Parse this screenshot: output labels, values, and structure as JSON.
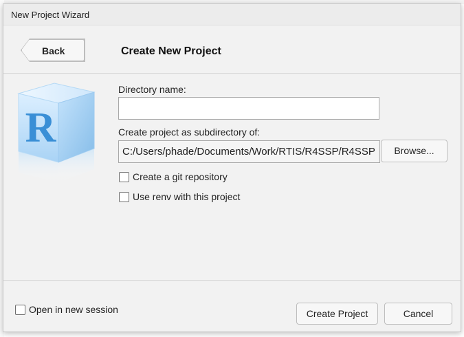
{
  "window": {
    "title": "New Project Wizard"
  },
  "header": {
    "back_label": "Back",
    "page_title": "Create New Project"
  },
  "form": {
    "directory_name": {
      "label": "Directory name:",
      "value": ""
    },
    "parent_dir": {
      "label": "Create project as subdirectory of:",
      "value": "C:/Users/phade/Documents/Work/RTIS/R4SSP/R4SSP",
      "browse_label": "Browse..."
    },
    "git_checkbox": {
      "label": "Create a git repository",
      "checked": false
    },
    "renv_checkbox": {
      "label": "Use renv with this project",
      "checked": false
    }
  },
  "footer": {
    "new_session": {
      "label": "Open in new session",
      "checked": false
    },
    "create_label": "Create Project",
    "cancel_label": "Cancel"
  },
  "logo": {
    "letter": "R"
  },
  "colors": {
    "dialog_bg": "#f2f2f2",
    "logo_blue": "#3a8fd6"
  }
}
